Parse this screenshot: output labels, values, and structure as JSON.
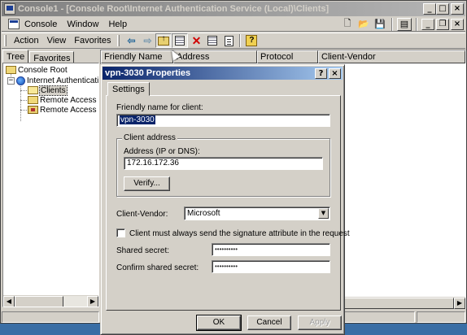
{
  "window": {
    "title": "Console1 - [Console Root\\Internet Authentication Service (Local)\\Clients]",
    "controls": {
      "minimize": "_",
      "maximize": "□",
      "close": "×"
    },
    "child_controls": {
      "minimize": "_",
      "restore": "❐",
      "close": "×"
    }
  },
  "menubar": {
    "console": "Console",
    "window": "Window",
    "help": "Help"
  },
  "toolbar": {
    "action": "Action",
    "view": "View",
    "favorites": "Favorites"
  },
  "tree": {
    "tabs": [
      "Tree",
      "Favorites"
    ],
    "items": [
      {
        "label": "Console Root",
        "icon": "folder-icon"
      },
      {
        "label": "Internet Authentication Service (Local)",
        "icon": "globe-icon"
      },
      {
        "label": "Clients",
        "icon": "folder-open-icon"
      },
      {
        "label": "Remote Access Logging",
        "icon": "folder-icon"
      },
      {
        "label": "Remote Access Policies",
        "icon": "policy-icon"
      }
    ]
  },
  "list": {
    "columns": [
      "Friendly Name",
      "Address",
      "Protocol",
      "Client-Vendor"
    ]
  },
  "dialog": {
    "title": "vpn-3030 Properties",
    "help": "?",
    "close": "×",
    "tab": "Settings",
    "friendly_name_label": "Friendly name for client:",
    "friendly_name_value": "vpn-3030",
    "client_address_group": "Client address",
    "address_label": "Address (IP or DNS):",
    "address_value": "172.16.172.36",
    "verify_button": "Verify...",
    "client_vendor_label": "Client-Vendor:",
    "client_vendor_value": "Microsoft",
    "signature_checkbox_label": "Client must always send the signature attribute in the request",
    "signature_checked": false,
    "shared_secret_label": "Shared secret:",
    "shared_secret_value": "••••••••••",
    "confirm_secret_label": "Confirm shared secret:",
    "confirm_secret_value": "••••••••••",
    "ok": "OK",
    "cancel": "Cancel",
    "apply": "Apply"
  },
  "colors": {
    "desktop": "#3a6ea5",
    "active_title_start": "#0a246a",
    "active_title_end": "#a6caf0",
    "inactive_title": "#808080",
    "face": "#d4d0c8"
  }
}
